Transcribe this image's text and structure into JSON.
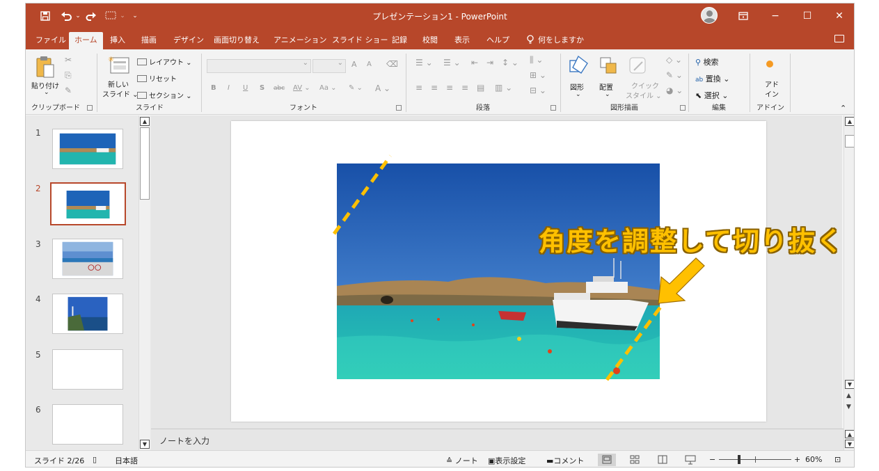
{
  "window": {
    "title": "プレゼンテーション1  -  PowerPoint",
    "qat": {
      "save_icon": "save-icon",
      "undo_icon": "undo-icon",
      "redo_icon": "redo-icon",
      "present_icon": "present-from-beginning-icon"
    },
    "controls": {
      "minimize": "−",
      "maximize": "☐",
      "close": "✕"
    },
    "accent": "#b7472a"
  },
  "tabs": [
    "ファイル",
    "ホーム",
    "挿入",
    "描画",
    "デザイン",
    "画面切り替え",
    "アニメーション",
    "スライド ショー",
    "記録",
    "校閲",
    "表示",
    "ヘルプ",
    "何をしますか"
  ],
  "active_tab": "ホーム",
  "ribbon": {
    "clipboard": {
      "paste": "貼り付け",
      "label": "クリップボード"
    },
    "slides": {
      "new_slide_1": "新しい",
      "new_slide_2": "スライド",
      "layout": "レイアウト",
      "reset": "リセット",
      "section": "セクション",
      "label": "スライド"
    },
    "font": {
      "bold": "B",
      "italic": "I",
      "underline": "U",
      "shadow": "S",
      "strike": "abc",
      "spacing": "AV",
      "case": "Aa",
      "color": "A",
      "grow": "A",
      "shrink": "A",
      "label": "フォント"
    },
    "paragraph": {
      "label": "段落"
    },
    "drawing": {
      "shapes": "図形",
      "arrange": "配置",
      "quick_style_1": "クイック",
      "quick_style_2": "スタイル",
      "label": "図形描画"
    },
    "editing": {
      "find": "検索",
      "replace": "置換",
      "select": "選択",
      "label": "編集"
    },
    "addins": {
      "name_1": "アド",
      "name_2": "イン",
      "label": "アドイン"
    }
  },
  "slides": [
    {
      "num": "1"
    },
    {
      "num": "2"
    },
    {
      "num": "3"
    },
    {
      "num": "4"
    },
    {
      "num": "5"
    },
    {
      "num": "6"
    }
  ],
  "current_slide": "2",
  "callout": "角度を調整して切り抜く",
  "notes_placeholder": "ノートを入力",
  "status": {
    "slide_info": "スライド 2/26",
    "language": "日本語",
    "notes": "ノート",
    "display_settings": "表示設定",
    "comments": "コメント",
    "zoom_level": "60%",
    "zoom_minus": "−",
    "zoom_plus": "+"
  },
  "colors": {
    "crop_line": "#ffc000",
    "callout_text": "#ffc000",
    "sky": "#1e64b8",
    "sea": "#20b8b0"
  }
}
